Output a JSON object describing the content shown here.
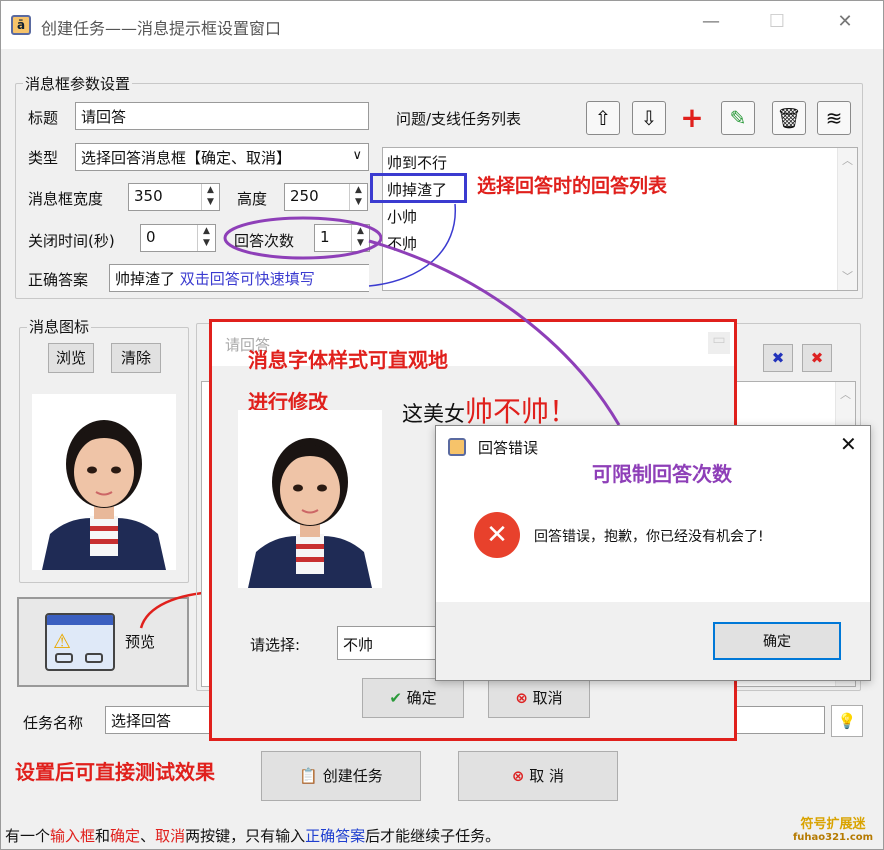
{
  "window": {
    "title": "创建任务——消息提示框设置窗口",
    "icon_glyph": "ā",
    "controls": [
      "—",
      "☐",
      "✕"
    ]
  },
  "settings": {
    "legend": "消息框参数设置",
    "title_label": "标题",
    "title_value": "请回答",
    "type_label": "类型",
    "type_value": "选择回答消息框【确定、取消】",
    "width_label": "消息框宽度",
    "width_value": "350",
    "height_label": "高度",
    "height_value": "250",
    "close_label": "关闭时间(秒)",
    "close_value": "0",
    "count_label": "回答次数",
    "count_value": "1",
    "answer_label": "正确答案",
    "answer_value": "帅掉渣了",
    "answer_hint": "双击回答可快速填写"
  },
  "question_list": {
    "label": "问题/支线任务列表",
    "items": [
      "帅到不行",
      "帅掉渣了",
      "小帅",
      "不帅"
    ],
    "toolbar": [
      "up-icon",
      "down-icon",
      "add-icon",
      "edit-icon",
      "delete-icon",
      "clear-icon"
    ]
  },
  "icon_group": {
    "legend": "消息图标",
    "browse": "浏览",
    "clear": "清除"
  },
  "preview": {
    "label": "预览"
  },
  "task": {
    "label": "任务名称",
    "value": "选择回答"
  },
  "buttons": {
    "create": "创建任务",
    "cancel": "取 消"
  },
  "footer": {
    "parts": [
      {
        "text": "有一个",
        "color": "#111111"
      },
      {
        "text": "输入框",
        "color": "#e0201c"
      },
      {
        "text": "和",
        "color": "#111111"
      },
      {
        "text": "确定",
        "color": "#e0201c"
      },
      {
        "text": "、",
        "color": "#111111"
      },
      {
        "text": "取消",
        "color": "#e0201c"
      },
      {
        "text": "两按键，只有输入",
        "color": "#111111"
      },
      {
        "text": "正确答案",
        "color": "#1f3fd0"
      },
      {
        "text": "后才能继续子任务。",
        "color": "#111111"
      }
    ]
  },
  "inner_dialog": {
    "title": "请回答",
    "message_black": "这美女",
    "message_red": "帅不帅！",
    "select_label": "请选择:",
    "select_value": "不帅",
    "ok": "确定",
    "cancel": "取消"
  },
  "error_dialog": {
    "title": "回答错误",
    "message": "回答错误，抱歉，你已经没有机会了!",
    "ok": "确定"
  },
  "annotations": {
    "answer_list": "选择回答时的回答列表",
    "font_style_1": "消息字体样式可直观地",
    "font_style_2": "进行修改",
    "limit": "可限制回答次数",
    "test": "设置后可直接测试效果"
  },
  "watermark": {
    "line1": "符号扩展迷",
    "line2": "fuhao321.com"
  },
  "colors": {
    "annotation_red": "#e0201c",
    "annotation_purple": "#8e3fb8",
    "highlight_blue": "#3b3bd0",
    "frame_red": "#e0201c"
  }
}
